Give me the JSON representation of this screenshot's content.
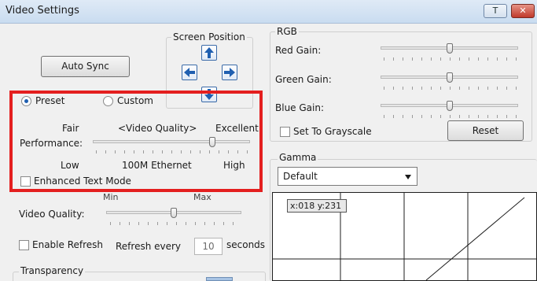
{
  "window": {
    "title": "Video Settings",
    "minimize_glyph": "T",
    "close_glyph": "✕"
  },
  "screen_position": {
    "title": "Screen Position",
    "up_icon": "arrow-up",
    "left_icon": "arrow-left",
    "right_icon": "arrow-right",
    "down_icon": "arrow-down"
  },
  "auto_sync": {
    "label": "Auto Sync"
  },
  "mode": {
    "preset_label": "Preset",
    "custom_label": "Custom",
    "selected": "Preset"
  },
  "performance": {
    "fair": "Fair",
    "video_quality": "<Video Quality>",
    "excellent": "Excellent",
    "label": "Performance:",
    "low": "Low",
    "middle": "100M Ethernet",
    "high": "High",
    "position": 0.77,
    "enhanced_text_label": "Enhanced Text Mode",
    "enhanced_text_checked": false
  },
  "video_quality": {
    "min": "Min",
    "max": "Max",
    "label": "Video Quality:",
    "position": 0.5
  },
  "refresh": {
    "enable_label": "Enable Refresh",
    "enabled": false,
    "every_label": "Refresh every",
    "value": "10",
    "unit": "seconds"
  },
  "transparency": {
    "title": "Transparency"
  },
  "rgb": {
    "title": "RGB",
    "red_label": "Red Gain:",
    "green_label": "Green Gain:",
    "blue_label": "Blue Gain:",
    "red_position": 0.5,
    "green_position": 0.5,
    "blue_position": 0.5,
    "grayscale_label": "Set To Grayscale",
    "grayscale_checked": false,
    "reset_label": "Reset"
  },
  "gamma": {
    "title": "Gamma",
    "selected": "Default",
    "coord_label": "x:018 y:231"
  },
  "colors": {
    "highlight_red": "#e41f1f",
    "accent_blue": "#1f5fb0"
  }
}
